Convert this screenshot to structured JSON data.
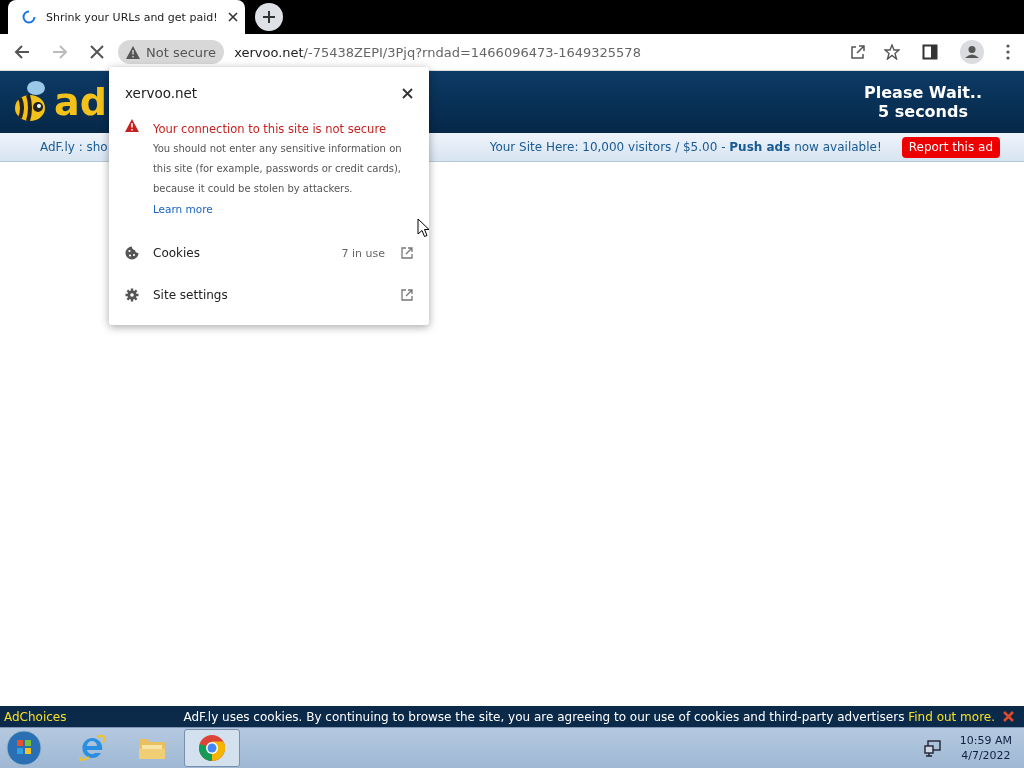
{
  "browser": {
    "tab": {
      "title": "Shrink your URLs and get paid!",
      "loading": true
    },
    "address": {
      "security": "Not secure",
      "url_host": "xervoo.net",
      "url_path": "/-75438ZEPI/3Pjq?rndad=1466096473-1649325578"
    }
  },
  "page": {
    "logo": "ad",
    "wait_line_1": "Please Wait..",
    "wait_line_2": "5 seconds",
    "subbar_left": "AdF.ly : sho",
    "promo": "Your Site Here: 10,000 visitors / $5.00 - **Push ads** now available!",
    "report_button": "Report this ad"
  },
  "site_info_popup": {
    "host": "xervoo.net",
    "warning_title": "Your connection to this site is not secure",
    "warning_text": "You should not enter any sensitive information on this site (for example, passwords or credit cards), because it could be stolen by attackers.",
    "learn_more": "Learn more",
    "items": [
      {
        "kind": "cookies",
        "label": "Cookies",
        "detail": "7 in use"
      },
      {
        "kind": "settings",
        "label": "Site settings"
      }
    ]
  },
  "cookie_bar": {
    "adchoices": "AdChoices",
    "message": "AdF.ly uses cookies. By continuing to browse the site, you are agreeing to our use of cookies and third-party advertisers",
    "link": "Find out more."
  },
  "taskbar": {
    "apps": [
      {
        "kind": "ie",
        "selected": false
      },
      {
        "kind": "folder",
        "selected": false
      },
      {
        "kind": "chrome",
        "selected": true
      }
    ],
    "time": "10:59 AM",
    "date": "4/7/2022"
  }
}
